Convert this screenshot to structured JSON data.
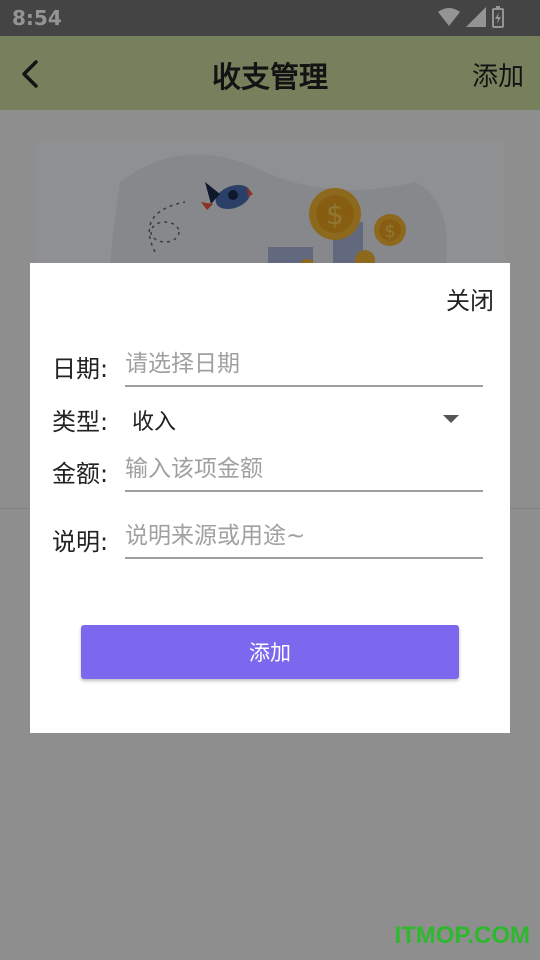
{
  "status_bar": {
    "time": "8:54"
  },
  "app_bar": {
    "title": "收支管理",
    "add_label": "添加"
  },
  "dialog": {
    "close_label": "关闭",
    "date": {
      "label": "日期:",
      "placeholder": "请选择日期"
    },
    "type": {
      "label": "类型:",
      "value": "收入"
    },
    "amount": {
      "label": "金额:",
      "placeholder": "输入该项金额"
    },
    "note": {
      "label": "说明:",
      "placeholder": "说明来源或用途~"
    },
    "submit_label": "添加"
  },
  "watermark": "ITMOP.COM",
  "colors": {
    "app_bar": "#cddca0",
    "primary_button": "#7b68ee",
    "watermark": "#2eb82e"
  }
}
